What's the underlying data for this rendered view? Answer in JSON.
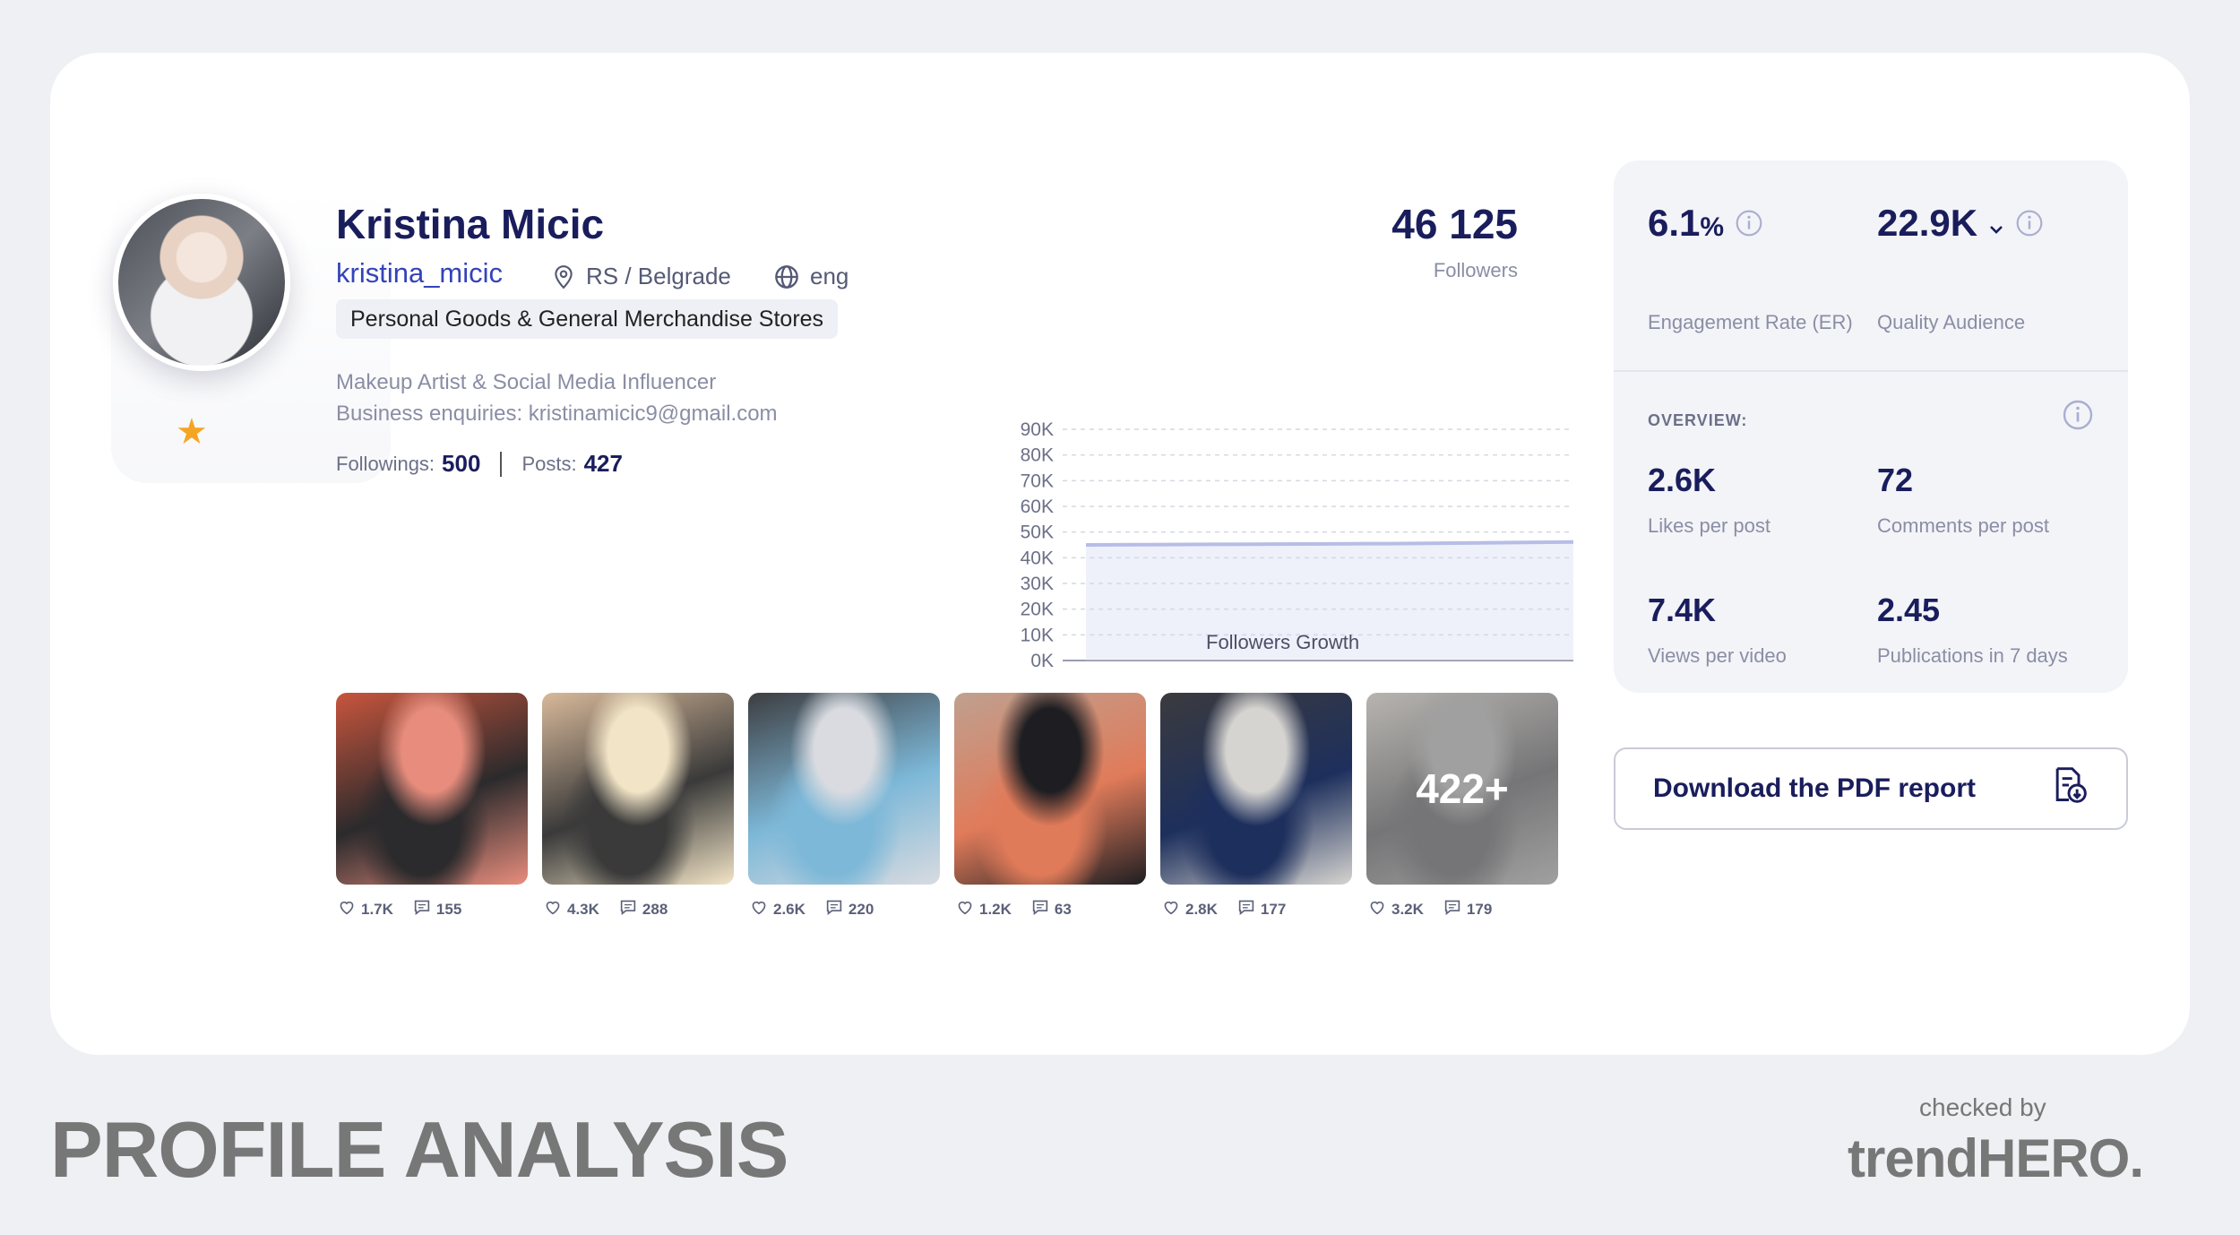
{
  "profile": {
    "name": "Kristina Micic",
    "handle": "kristina_micic",
    "location": "RS / Belgrade",
    "language": "eng",
    "category": "Personal Goods & General Merchandise Stores",
    "bio_line1": "Makeup Artist & Social Media Influencer",
    "bio_line2": "Business enquiries: kristinamicic9@gmail.com",
    "followings_label": "Followings:",
    "followings": "500",
    "posts_label": "Posts:",
    "posts": "427"
  },
  "followers": {
    "value": "46 125",
    "label": "Followers"
  },
  "chart_data": {
    "type": "area",
    "title": "",
    "xlabel": "Followers Growth",
    "ylabel": "",
    "yticks": [
      "0K",
      "10K",
      "20K",
      "30K",
      "40K",
      "50K",
      "60K",
      "70K",
      "80K",
      "90K"
    ],
    "ylim": [
      0,
      90000
    ],
    "series": [
      {
        "values": [
          45000,
          45100,
          45200,
          45300,
          45400,
          45500,
          45700,
          45900,
          46125
        ]
      }
    ],
    "grid": true,
    "color": "#b7bde6"
  },
  "posts": [
    {
      "likes": "1.7K",
      "comments": "155",
      "colors": [
        "#e88d7d",
        "#2b2a2c",
        "#c8553d"
      ]
    },
    {
      "likes": "4.3K",
      "comments": "288",
      "colors": [
        "#f2e4c6",
        "#3a3a3a",
        "#d8b99a"
      ]
    },
    {
      "likes": "2.6K",
      "comments": "220",
      "colors": [
        "#d9dbe0",
        "#7db8d8",
        "#3d3d40"
      ]
    },
    {
      "likes": "1.2K",
      "comments": "63",
      "colors": [
        "#1e1e22",
        "#e07b5a",
        "#bfa08f"
      ]
    },
    {
      "likes": "2.8K",
      "comments": "177",
      "colors": [
        "#d6d4d0",
        "#1d2f5c",
        "#3b3b3e"
      ]
    },
    {
      "likes": "3.2K",
      "comments": "179",
      "colors": [
        "#bdbdbd",
        "#8a8a8c",
        "#d8d4cf"
      ],
      "overlay": "422+"
    }
  ],
  "metrics": {
    "er_value": "6.1",
    "er_unit": "%",
    "er_label": "Engagement Rate (ER)",
    "qa_value": "22.9K",
    "qa_label": "Quality Audience"
  },
  "overview": {
    "title": "OVERVIEW:",
    "likes_value": "2.6K",
    "likes_label": "Likes per post",
    "comments_value": "72",
    "comments_label": "Comments per post",
    "views_value": "7.4K",
    "views_label": "Views per video",
    "pubs_value": "2.45",
    "pubs_label": "Publications in 7 days"
  },
  "download": {
    "label": "Download the PDF report"
  },
  "footer": {
    "title": "PROFILE ANALYSIS",
    "checked_by": "checked by",
    "brand": "trendHERO."
  },
  "colors": {
    "accent": "#1a1d5c",
    "link": "#3443b8",
    "star": "#f5a524",
    "background": "#eff0f4"
  }
}
